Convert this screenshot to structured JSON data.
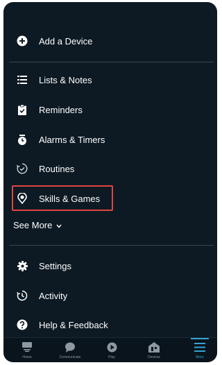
{
  "menu": {
    "add_device": "Add a Device",
    "lists_notes": "Lists & Notes",
    "reminders": "Reminders",
    "alarms_timers": "Alarms & Timers",
    "routines": "Routines",
    "skills_games": "Skills & Games",
    "see_more": "See More",
    "settings": "Settings",
    "activity": "Activity",
    "help_feedback": "Help & Feedback"
  },
  "bottom_nav": {
    "tabs": [
      {
        "label": "Home",
        "icon": "home-icon"
      },
      {
        "label": "Communicate",
        "icon": "chat-bubble-icon"
      },
      {
        "label": "Play",
        "icon": "play-icon"
      },
      {
        "label": "Devices",
        "icon": "devices-icon"
      },
      {
        "label": "More",
        "icon": "hamburger-menu-icon",
        "active": true
      }
    ]
  },
  "colors": {
    "background": "#0d1a24",
    "highlight_border": "#e1453f",
    "active_accent": "#36a3d6"
  }
}
